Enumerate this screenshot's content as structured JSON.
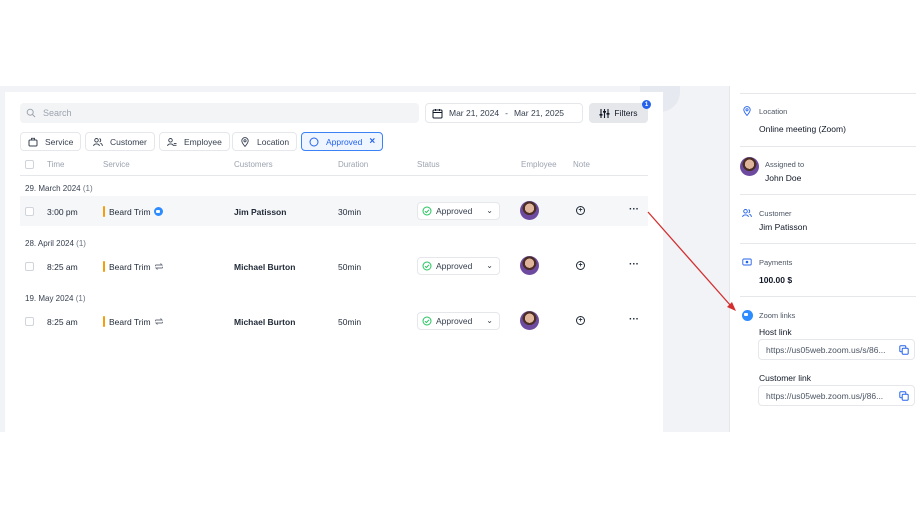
{
  "toolbar": {
    "search_placeholder": "Search",
    "date_from": "Mar 21, 2024",
    "date_sep": "-",
    "date_to": "Mar 21, 2025",
    "filters_label": "Filters",
    "filters_count": "1"
  },
  "chips": {
    "service": "Service",
    "customer": "Customer",
    "employee": "Employee",
    "location": "Location",
    "approved": "Approved"
  },
  "table": {
    "headers": {
      "time": "Time",
      "service": "Service",
      "customers": "Customers",
      "duration": "Duration",
      "status": "Status",
      "employee": "Employee",
      "note": "Note"
    },
    "groups": [
      {
        "date": "29. March 2024",
        "count": "(1)"
      },
      {
        "date": "28. April 2024",
        "count": "(1)"
      },
      {
        "date": "19. May 2024",
        "count": "(1)"
      }
    ],
    "rows": [
      {
        "time": "3:00 pm",
        "service": "Beard Trim",
        "customer": "Jim Patisson",
        "duration": "30min",
        "status": "Approved",
        "service_icon": "zoom-icon"
      },
      {
        "time": "8:25 am",
        "service": "Beard Trim",
        "customer": "Michael Burton",
        "duration": "50min",
        "status": "Approved",
        "service_icon": "recurring-icon"
      },
      {
        "time": "8:25 am",
        "service": "Beard Trim",
        "customer": "Michael Burton",
        "duration": "50min",
        "status": "Approved",
        "service_icon": "recurring-icon"
      }
    ]
  },
  "details": {
    "location_label": "Location",
    "location_value": "Online meeting (Zoom)",
    "assigned_label": "Assigned to",
    "assigned_value": "John Doe",
    "customer_label": "Customer",
    "customer_value": "Jim Patisson",
    "payments_label": "Payments",
    "payments_value": "100.00 $",
    "zoom_label": "Zoom links",
    "host_label": "Host link",
    "host_url": "https://us05web.zoom.us/s/86...",
    "customer_link_label": "Customer link",
    "customer_url": "https://us05web.zoom.us/j/86..."
  },
  "colors": {
    "accent": "#2563eb",
    "status_ok": "#22c55e",
    "service_bar": "#f59e0b",
    "arrow": "#d32f2f"
  }
}
